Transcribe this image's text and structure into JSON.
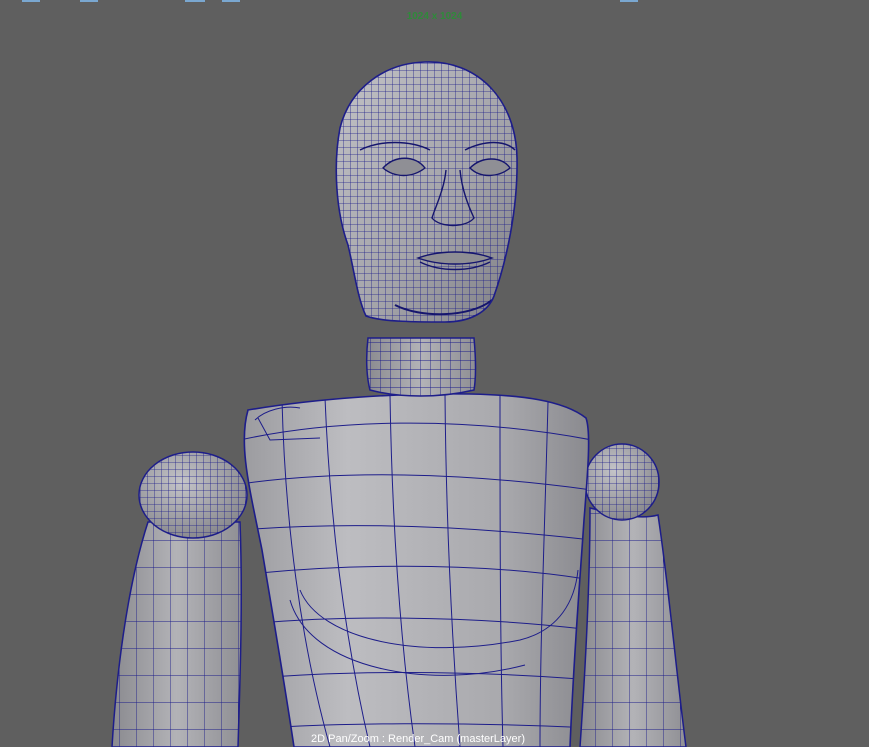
{
  "viewport": {
    "resolution_gate_label": "1024 x 1024",
    "hud_camera_label": "2D Pan/Zoom : Render_Cam (masterLayer)",
    "colors": {
      "background": "#5f5f5f",
      "wireframe": "#1d1d8a",
      "surface": "#a2a2a6",
      "resolution_text": "#2f8a3a"
    }
  }
}
